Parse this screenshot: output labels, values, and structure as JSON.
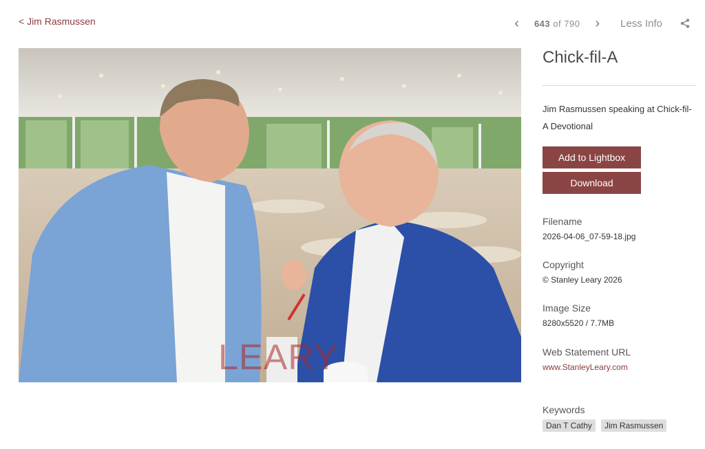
{
  "nav": {
    "back_label": "< Jim Rasmussen",
    "current": "643",
    "of_label": "of",
    "total": "790",
    "less_info_label": "Less Info"
  },
  "photo": {
    "watermark": "LEARY"
  },
  "info": {
    "title": "Chick-fil-A",
    "description": "Jim Rasmussen speaking at Chick-fil-A Devotional",
    "add_to_lightbox": "Add to Lightbox",
    "download": "Download",
    "filename_label": "Filename",
    "filename": "2026-04-06_07-59-18.jpg",
    "copyright_label": "Copyright",
    "copyright": "© Stanley Leary 2026",
    "image_size_label": "Image Size",
    "image_size": "8280x5520 / 7.7MB",
    "web_statement_label": "Web Statement URL",
    "web_statement_url": "www.StanleyLeary.com",
    "keywords_label": "Keywords",
    "keywords": [
      "Dan T Cathy",
      "Jim Rasmussen"
    ]
  },
  "colors": {
    "accent": "#8b4444",
    "link": "#8a3c3c"
  }
}
